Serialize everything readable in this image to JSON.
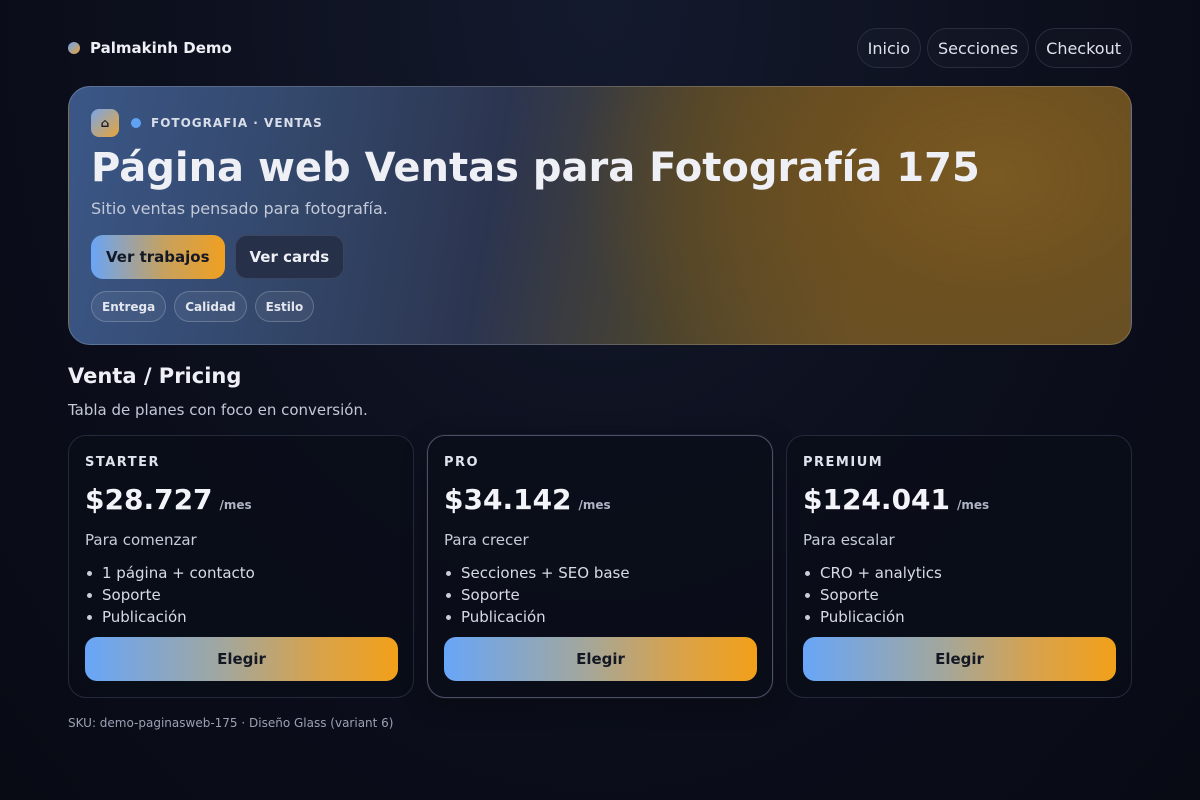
{
  "brand": {
    "name": "Palmakinh Demo"
  },
  "nav": {
    "items": [
      "Inicio",
      "Secciones",
      "Checkout"
    ]
  },
  "hero": {
    "icon_glyph": "⌂",
    "kicker": "FOTOGRAFIA · VENTAS",
    "title": "Página web Ventas para Fotografía 175",
    "subtitle": "Sitio ventas pensado para fotografía.",
    "primary_button": "Ver trabajos",
    "secondary_button": "Ver cards",
    "chips": [
      "Entrega",
      "Calidad",
      "Estilo"
    ]
  },
  "section": {
    "title": "Venta / Pricing",
    "subtitle": "Tabla de planes con foco en conversión."
  },
  "plans": [
    {
      "name": "STARTER",
      "price": "$28.727",
      "period": "/mes",
      "tagline": "Para comenzar",
      "features": [
        "1 página + contacto",
        "Soporte",
        "Publicación"
      ],
      "button": "Elegir",
      "featured": false
    },
    {
      "name": "PRO",
      "price": "$34.142",
      "period": "/mes",
      "tagline": "Para crecer",
      "features": [
        "Secciones + SEO base",
        "Soporte",
        "Publicación"
      ],
      "button": "Elegir",
      "featured": true
    },
    {
      "name": "PREMIUM",
      "price": "$124.041",
      "period": "/mes",
      "tagline": "Para escalar",
      "features": [
        "CRO + analytics",
        "Soporte",
        "Publicación"
      ],
      "button": "Elegir",
      "featured": false
    }
  ],
  "footer": {
    "text": "SKU: demo-paginasweb-175 · Diseño Glass (variant 6)"
  },
  "colors": {
    "accent_blue": "#6aa5f6",
    "accent_orange": "#f0a020",
    "background": "#0c0f1c"
  }
}
